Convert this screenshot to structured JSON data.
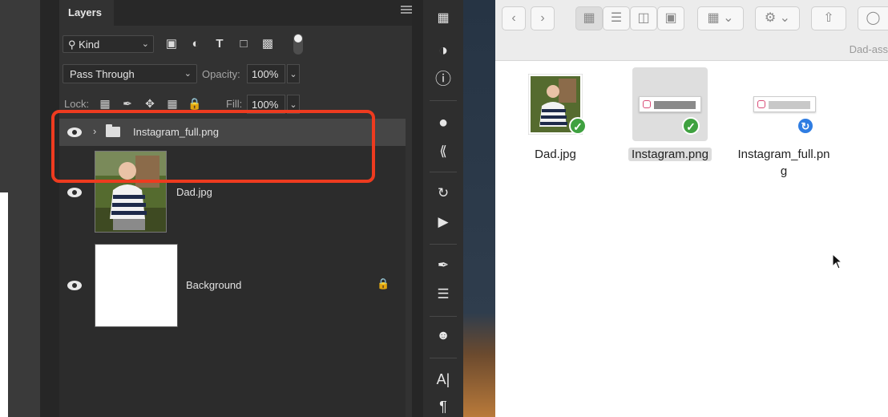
{
  "layers_panel": {
    "tab_title": "Layers",
    "filter_kind": "Kind",
    "blend_mode": "Pass Through",
    "opacity_label": "Opacity:",
    "opacity_value": "100%",
    "lock_label": "Lock:",
    "fill_label": "Fill:",
    "fill_value": "100%",
    "layers": [
      {
        "name": "Instagram_full.png",
        "type": "group",
        "visible": true,
        "selected": true
      },
      {
        "name": "Dad.jpg",
        "type": "image",
        "visible": true
      },
      {
        "name": "Background",
        "type": "background",
        "visible": true,
        "locked": true
      }
    ]
  },
  "tools": [
    "3d-cube-icon",
    "adjustments-icon",
    "info-icon",
    "color-swatches-icon",
    "path-icon",
    "history-icon",
    "play-icon",
    "brush-presets-icon",
    "properties-icon",
    "clone-source-icon",
    "character-icon",
    "paragraph-icon"
  ],
  "finder": {
    "path_label": "Dad-ass",
    "files": [
      {
        "name": "Dad.jpg",
        "status": "synced"
      },
      {
        "name": "Instagram.png",
        "status": "synced",
        "selected": true
      },
      {
        "name_line1": "Instagram_full.pn",
        "name_line2": "g",
        "status": "syncing"
      }
    ]
  },
  "colors": {
    "highlight": "#ee3b1f",
    "synced_badge": "#3fa140",
    "syncing_badge": "#2f7de2"
  }
}
